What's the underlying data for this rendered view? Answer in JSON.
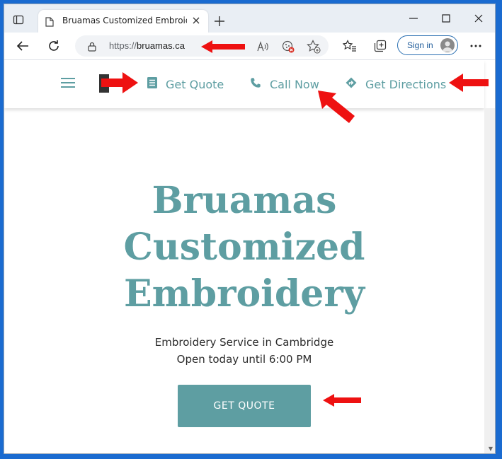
{
  "browser": {
    "tab_title": "Bruamas Customized Embroidery",
    "url_scheme": "https://",
    "url_domain": "bruamas.ca",
    "sign_in_label": "Sign in"
  },
  "site_nav": {
    "links": [
      {
        "label": "Get Quote",
        "icon": "document-icon"
      },
      {
        "label": "Call Now",
        "icon": "phone-icon"
      },
      {
        "label": "Get Directions",
        "icon": "directions-icon"
      }
    ]
  },
  "hero": {
    "title_lines": [
      "Bruamas",
      "Customized",
      "Embroidery"
    ],
    "subtitle": "Embroidery Service in Cambridge",
    "hours": "Open today until 6:00 PM",
    "cta_label": "GET QUOTE"
  },
  "colors": {
    "accent": "#5e9ea2",
    "annotation_arrow": "#ee1111",
    "desktop": "#1a6bd0"
  }
}
